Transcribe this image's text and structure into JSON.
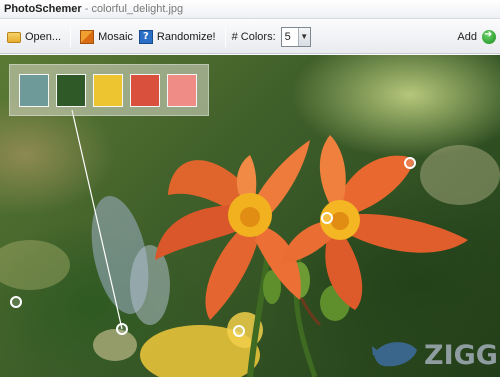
{
  "window": {
    "app_name": "PhotoSchemer",
    "separator": "-",
    "file_name": "colorful_delight.jpg"
  },
  "toolbar": {
    "open_label": "Open...",
    "mosaic_label": "Mosaic",
    "randomize_label": "Randomize!",
    "colors_label": "# Colors:",
    "colors_value": "5",
    "add_label": "Add"
  },
  "palette": {
    "swatches": [
      {
        "name": "slate-teal",
        "color": "#6f9a9a"
      },
      {
        "name": "forest-green",
        "color": "#2f5a27"
      },
      {
        "name": "sun-yellow",
        "color": "#ecc531"
      },
      {
        "name": "tomato-red",
        "color": "#d9503c"
      },
      {
        "name": "salmon",
        "color": "#ef8c85"
      }
    ]
  },
  "watermark": {
    "text": "ZIGG"
  }
}
